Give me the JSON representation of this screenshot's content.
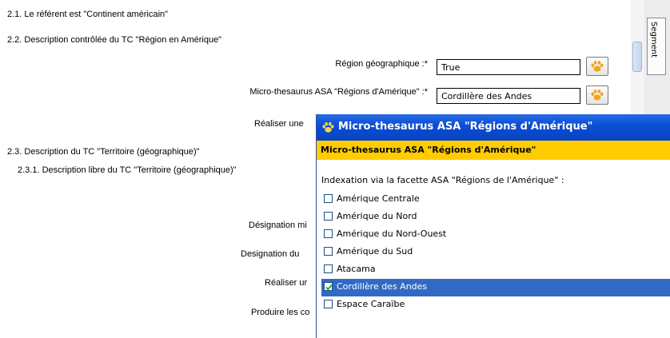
{
  "sections": {
    "s21": "2.1. Le référent est \"Continent américain\"",
    "s22": "2.2. Description contrôlée du TC \"Région en Amérique\"",
    "s23": "2.3. Description du TC \"Territoire (géographique)\"",
    "s231": "2.3.1. Description libre du TC \"Territoire (géographique)\""
  },
  "form": {
    "region_label": "Région géographique :*",
    "region_value": "True",
    "micro_label": "Micro-thesaurus ASA \"Régions d'Amérique\" :*",
    "micro_value": "Cordillère des Andes",
    "realiser1": "Réaliser une",
    "designation_mi": "Désignation mi",
    "designation_du": "Designation du",
    "realiser2": "Réaliser ur",
    "produire": "Produire les co"
  },
  "right_panel": {
    "tab_label": "Segment"
  },
  "popup": {
    "title": "Micro-thesaurus ASA \"Régions d'Amérique\"",
    "subtitle": "Micro-thesaurus ASA \"Régions d'Amérique\"",
    "facet_label": "Indexation via la facette ASA \"Régions de l'Amérique\" :",
    "items": [
      {
        "label": "Amérique Centrale",
        "checked": false
      },
      {
        "label": "Amérique du Nord",
        "checked": false
      },
      {
        "label": "Amérique du Nord-Ouest",
        "checked": false
      },
      {
        "label": "Amérique du Sud",
        "checked": false
      },
      {
        "label": "Atacama",
        "checked": false
      },
      {
        "label": "Cordillère des Andes",
        "checked": true
      },
      {
        "label": "Espace Caraïbe",
        "checked": false
      }
    ]
  },
  "colors": {
    "title_bar": "#0a4fd6",
    "subtitle_bar": "#ffcc00",
    "selection": "#316ac5",
    "check": "#21a121"
  },
  "icons": [
    "paw-icon",
    "check-icon"
  ]
}
